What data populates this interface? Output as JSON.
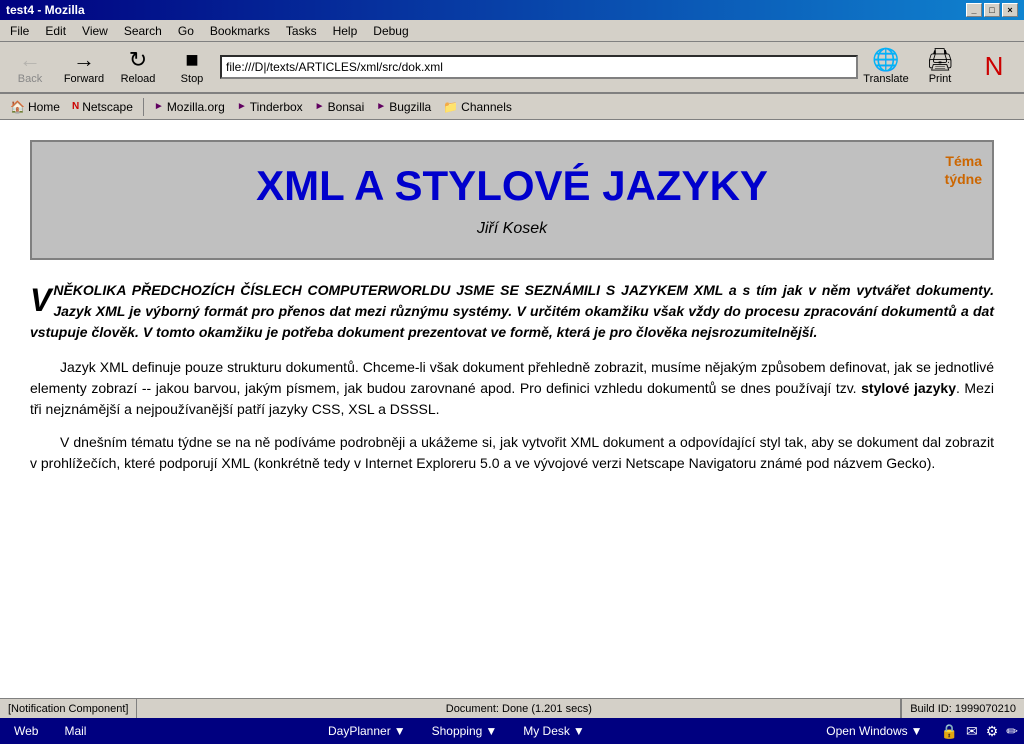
{
  "titlebar": {
    "title": "test4 - Mozilla",
    "buttons": [
      "_",
      "□",
      "×"
    ]
  },
  "menubar": {
    "items": [
      "File",
      "Edit",
      "View",
      "Search",
      "Go",
      "Bookmarks",
      "Tasks",
      "Help",
      "Debug"
    ]
  },
  "toolbar": {
    "back_label": "Back",
    "forward_label": "Forward",
    "reload_label": "Reload",
    "stop_label": "Stop",
    "translate_label": "Translate",
    "print_label": "Print",
    "url": "file:///D|/texts/ARTICLES/xml/src/dok.xml"
  },
  "bookmarks": {
    "home_label": "Home",
    "netscape_label": "Netscape",
    "mozilla_label": "Mozilla.org",
    "tinderbox_label": "Tinderbox",
    "bonsai_label": "Bonsai",
    "bugzilla_label": "Bugzilla",
    "channels_label": "Channels"
  },
  "article": {
    "title": "XML A STYLOVÉ JAZYKY",
    "author": "Jiří Kosek",
    "tema_line1": "Téma",
    "tema_line2": "týdne",
    "intro_drop": "V",
    "intro_text": "NĚKOLIKA PŘEDCHOZÍCH ČÍSLECH COMPUTERWORLDU JSME SE SEZNÁMILI S JAZYKEM XML a s tím jak v něm vytvářet dokumenty. Jazyk XML je výborný formát pro přenos dat mezi různýmu systémy. V určitém okamžiku však vždy do procesu zpracování dokumentů a dat vstupuje člověk. V tomto okamžiku je potřeba dokument prezentovat ve formě, která je pro člověka nejsrozumitelnější.",
    "para1": "Jazyk XML definuje pouze strukturu dokumentů. Chceme-li však dokument přehledně zobrazit, musíme nějakým způsobem definovat, jak se jednotlivé elementy zobrazí -- jakou barvou, jakým písmem, jak budou zarovnané apod. Pro definici vzhledu dokumentů se dnes používají tzv. stylové jazyky. Mezi tři nejznámější a nejpoužívanější patří jazyky CSS, XSL a DSSSL.",
    "para2": "V dnešním tématu týdne se na ně podíváme podrobněji a ukážeme si, jak vytvořit XML dokument a odpovídající styl tak, aby se dokument dal zobrazit v prohlížečích, které podporují XML (konkrétně tedy v Internet Exploreru 5.0 a ve vývojové verzi Netscape Navigatoru známé pod názvem Gecko)."
  },
  "statusbar": {
    "notification": "[Notification Component]",
    "document_status": "Document: Done (1.201 secs)",
    "build_id": "Build ID: 1999070210"
  },
  "bottombar": {
    "web_label": "Web",
    "mail_label": "Mail",
    "dayplanner_label": "DayPlanner",
    "shopping_label": "Shopping",
    "mydesk_label": "My Desk",
    "openwindows_label": "Open Windows"
  }
}
